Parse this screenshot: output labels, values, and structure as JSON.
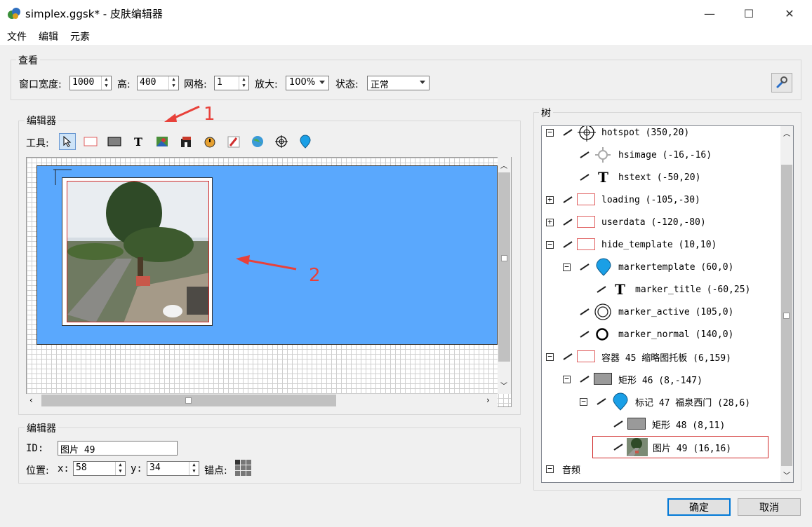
{
  "window": {
    "title": "simplex.ggsk* - 皮肤编辑器",
    "minimize": "—",
    "maximize": "☐",
    "close": "✕"
  },
  "menu": [
    "文件",
    "编辑",
    "元素"
  ],
  "view": {
    "group_title": "查看",
    "window_width_label": "窗口宽度:",
    "window_width": "1000",
    "height_label": "高:",
    "height": "400",
    "grid_label": "网格:",
    "grid": "1",
    "zoom_label": "放大:",
    "zoom": "100%",
    "state_label": "状态:",
    "state": "正常"
  },
  "editor": {
    "group_title": "编辑器",
    "tools_label": "工具:",
    "tools": [
      "pointer-tool",
      "rectangle-tool",
      "container-tool",
      "text-tool",
      "image-tool",
      "cloner-tool",
      "timer-tool",
      "flash-tool",
      "map-tool",
      "hotspot-tool",
      "marker-tool"
    ]
  },
  "annotations": {
    "arrow1": "1",
    "arrow2": "2"
  },
  "properties": {
    "group_title": "编辑器",
    "id_label": "ID:",
    "id_value": "图片 49",
    "position_label": "位置:",
    "x_label": "x:",
    "x_value": "58",
    "y_label": "y:",
    "y_value": "34",
    "anchor_label": "锚点:"
  },
  "tree": {
    "title": "树",
    "nodes": [
      {
        "text": "hotspot (350,20)"
      },
      {
        "text": "hsimage (-16,-16)"
      },
      {
        "text": "hstext (-50,20)"
      },
      {
        "text": "loading (-105,-30)"
      },
      {
        "text": "userdata (-120,-80)"
      },
      {
        "text": "hide_template (10,10)"
      },
      {
        "text": "markertemplate (60,0)"
      },
      {
        "text": "marker_title (-60,25)"
      },
      {
        "text": "marker_active (105,0)"
      },
      {
        "text": "marker_normal (140,0)"
      },
      {
        "text": "容器 45 缩略图托板 (6,159)"
      },
      {
        "text": "矩形 46 (8,-147)"
      },
      {
        "text": "标记 47 福泉西门 (28,6)"
      },
      {
        "text": "矩形 48 (8,11)"
      },
      {
        "text": "图片 49 (16,16)"
      },
      {
        "text": "音频"
      }
    ]
  },
  "buttons": {
    "ok": "确定",
    "cancel": "取消"
  },
  "colors": {
    "canvas_blue": "#5aa8fd",
    "selection_red": "#e03030",
    "marker_blue": "#1a9fe6"
  }
}
